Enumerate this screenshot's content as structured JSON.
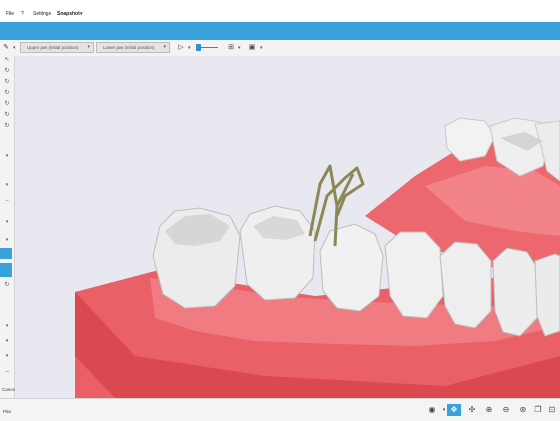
{
  "menu": {
    "file": "File",
    "help": "?",
    "settings": "Settings",
    "snapshot": "Snapshot"
  },
  "toolbar": {
    "upper_jaw": "Upper jaw (initial position)",
    "lower_jaw": "Lower jaw (initial position)"
  },
  "sidebar": {
    "cancel": "Cancel"
  },
  "status": {
    "mode": "Pan"
  },
  "colors": {
    "accent": "#3aa2db",
    "gum": "#e96066",
    "tooth": "#ededed",
    "clamp": "#8c8856"
  },
  "icons": {
    "play": "play-icon",
    "view": "eye-icon",
    "active_tool": "pan-tool-icon"
  }
}
